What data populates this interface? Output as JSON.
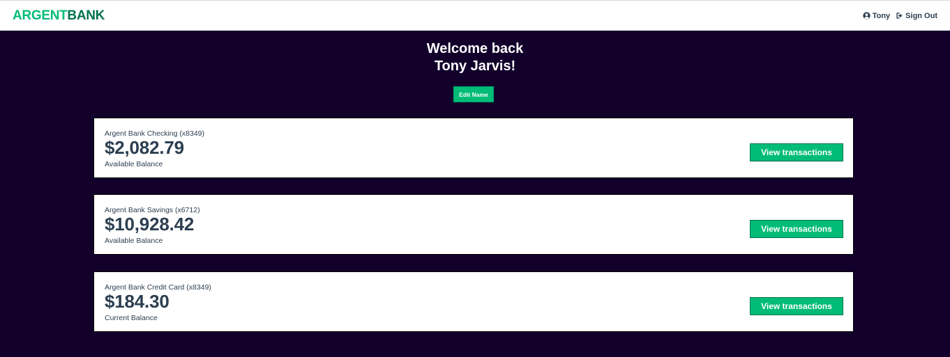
{
  "nav": {
    "logo_part1": "ARGENT",
    "logo_part2": "BANK",
    "user_name": "Tony",
    "user_icon": "user-circle-icon",
    "sign_out_label": "Sign Out",
    "sign_out_icon": "sign-out-icon"
  },
  "header": {
    "welcome_line1": "Welcome back",
    "welcome_line2": "Tony Jarvis!",
    "edit_button": "Edit Name"
  },
  "accounts": [
    {
      "title": "Argent Bank Checking (x8349)",
      "amount": "$2,082.79",
      "description": "Available Balance",
      "button": "View transactions"
    },
    {
      "title": "Argent Bank Savings (x6712)",
      "amount": "$10,928.42",
      "description": "Available Balance",
      "button": "View transactions"
    },
    {
      "title": "Argent Bank Credit Card (x8349)",
      "amount": "$184.30",
      "description": "Current Balance",
      "button": "View transactions"
    }
  ],
  "colors": {
    "brand_green": "#00bc77",
    "dark_green": "#00734a",
    "background": "#12002b",
    "text": "#2c3e50"
  }
}
